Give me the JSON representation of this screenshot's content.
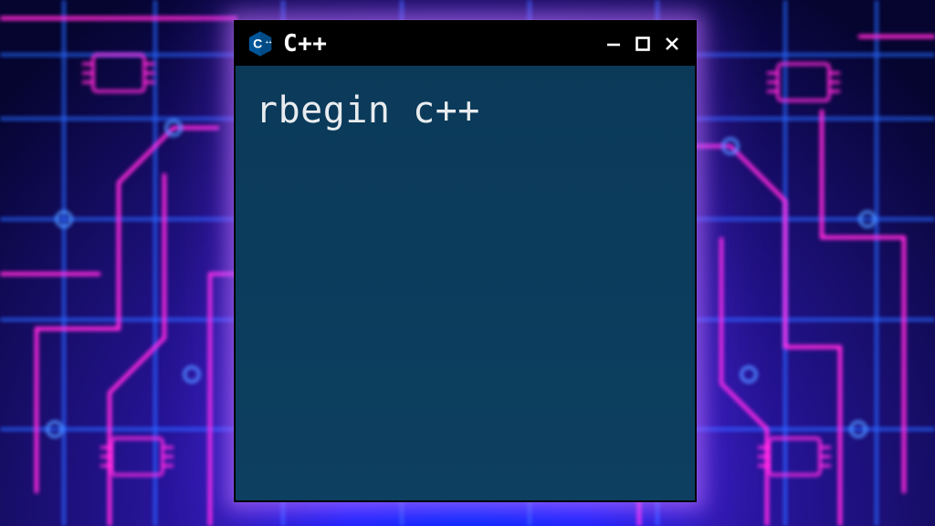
{
  "window": {
    "title": "C++",
    "icon": "cpp-logo-icon",
    "content": "rbegin c++"
  },
  "colors": {
    "terminal_bg": "#0b3a59",
    "titlebar_bg": "#000000",
    "text": "#e8ecef",
    "glow": "#c878ff"
  }
}
